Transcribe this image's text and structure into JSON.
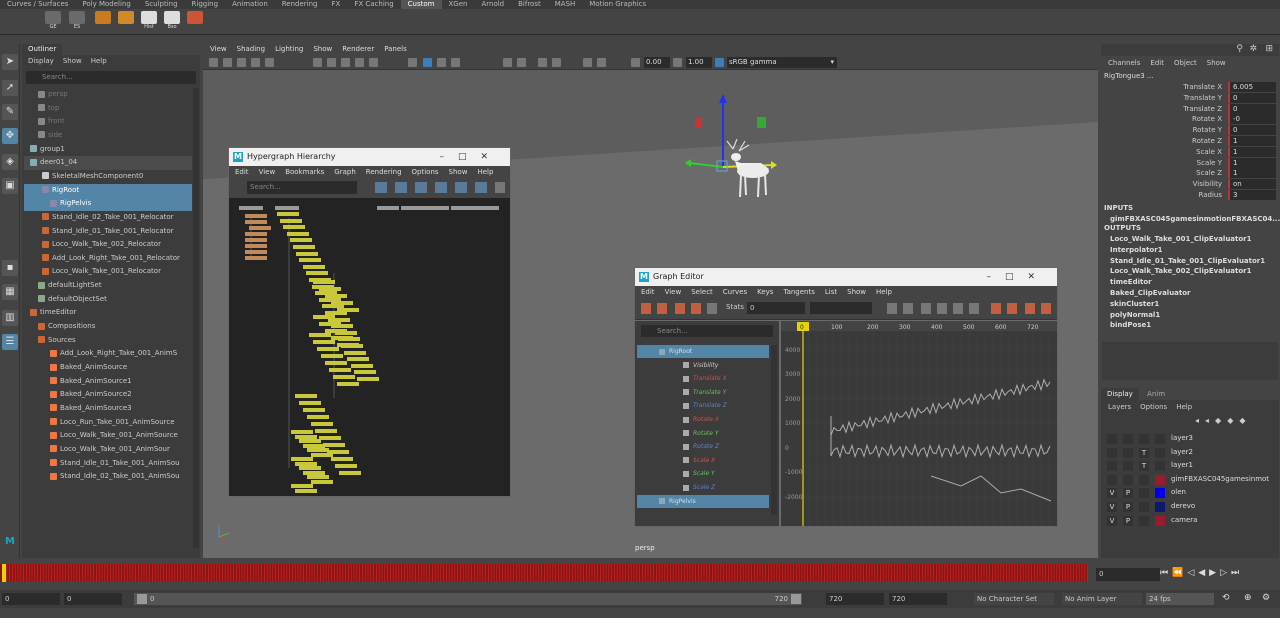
{
  "shelf": {
    "tabs": [
      "Curves / Surfaces",
      "Poly Modeling",
      "Sculpting",
      "Rigging",
      "Animation",
      "Rendering",
      "FX",
      "FX Caching",
      "Custom",
      "XGen",
      "Arnold",
      "Bifrost",
      "MASH",
      "Motion Graphics"
    ],
    "active_tab": "Custom",
    "buttons": [
      "GE",
      "ES",
      "",
      "",
      "Hist",
      "Bso",
      ""
    ]
  },
  "outliner": {
    "title": "Outliner",
    "menu": [
      "Display",
      "Show",
      "Help"
    ],
    "search_placeholder": "Search...",
    "items": [
      {
        "label": "persp",
        "state": "dim"
      },
      {
        "label": "top",
        "state": "dim"
      },
      {
        "label": "front",
        "state": "dim"
      },
      {
        "label": "side",
        "state": "dim"
      },
      {
        "label": "group1",
        "state": ""
      },
      {
        "label": "deer01_04",
        "state": "hl"
      },
      {
        "label": "SkeletalMeshComponent0",
        "state": ""
      },
      {
        "label": "RigRoot",
        "state": "sel"
      },
      {
        "label": "RigPelvis",
        "state": "sel"
      },
      {
        "label": "Stand_Idle_02_Take_001_Relocator",
        "state": ""
      },
      {
        "label": "Stand_Idle_01_Take_001_Relocator",
        "state": ""
      },
      {
        "label": "Loco_Walk_Take_002_Relocator",
        "state": ""
      },
      {
        "label": "Add_Look_Right_Take_001_Relocator",
        "state": ""
      },
      {
        "label": "Loco_Walk_Take_001_Relocator",
        "state": ""
      },
      {
        "label": "defaultLightSet",
        "state": ""
      },
      {
        "label": "defaultObjectSet",
        "state": ""
      },
      {
        "label": "timeEditor",
        "state": ""
      },
      {
        "label": "Compositions",
        "state": ""
      },
      {
        "label": "Sources",
        "state": ""
      },
      {
        "label": "Add_Look_Right_Take_001_AnimS",
        "state": ""
      },
      {
        "label": "Baked_AnimSource",
        "state": ""
      },
      {
        "label": "Baked_AnimSource1",
        "state": ""
      },
      {
        "label": "Baked_AnimSource2",
        "state": ""
      },
      {
        "label": "Baked_AnimSource3",
        "state": ""
      },
      {
        "label": "Loco_Run_Take_001_AnimSource",
        "state": ""
      },
      {
        "label": "Loco_Walk_Take_001_AnimSource",
        "state": ""
      },
      {
        "label": "Loco_Walk_Take_001_AnimSour",
        "state": ""
      },
      {
        "label": "Stand_Idle_01_Take_001_AnimSou",
        "state": ""
      },
      {
        "label": "Stand_Idle_02_Take_001_AnimSou",
        "state": ""
      }
    ]
  },
  "viewport": {
    "menu": [
      "View",
      "Shading",
      "Lighting",
      "Show",
      "Renderer",
      "Panels"
    ],
    "field_a": "0.00",
    "field_b": "1.00",
    "color_space": "sRGB gamma",
    "camera_label": "persp"
  },
  "hypergraph": {
    "title": "Hypergraph Hierarchy",
    "menu": [
      "Edit",
      "View",
      "Bookmarks",
      "Graph",
      "Rendering",
      "Options",
      "Show",
      "Help"
    ],
    "search_placeholder": "Search..."
  },
  "graph_editor": {
    "title": "Graph Editor",
    "menu": [
      "Edit",
      "View",
      "Select",
      "Curves",
      "Keys",
      "Tangents",
      "List",
      "Show",
      "Help"
    ],
    "stats_label": "Stats",
    "stats_value": "0",
    "search_placeholder": "Search...",
    "channels": [
      {
        "label": "RigRoot",
        "color": "#cfe4f0",
        "sel": true
      },
      {
        "label": "Visibility",
        "color": "#cccccc",
        "sel": false
      },
      {
        "label": "Translate X",
        "color": "#d05050",
        "sel": false
      },
      {
        "label": "Translate Y",
        "color": "#60c060",
        "sel": false
      },
      {
        "label": "Translate Z",
        "color": "#6080d0",
        "sel": false
      },
      {
        "label": "Rotate X",
        "color": "#d05050",
        "sel": false
      },
      {
        "label": "Rotate Y",
        "color": "#60c060",
        "sel": false
      },
      {
        "label": "Rotate Z",
        "color": "#6080d0",
        "sel": false
      },
      {
        "label": "Scale X",
        "color": "#d05050",
        "sel": false
      },
      {
        "label": "Scale Y",
        "color": "#60c060",
        "sel": false
      },
      {
        "label": "Scale Z",
        "color": "#6080d0",
        "sel": false
      },
      {
        "label": "RigPelvis",
        "color": "#cfe4f0",
        "sel": true
      }
    ],
    "frame_ruler": [
      "0",
      "100",
      "200",
      "300",
      "400",
      "500",
      "600",
      "720"
    ],
    "current_frame": "0",
    "value_ticks": [
      "4000",
      "3000",
      "2000",
      "1000",
      "0",
      "-1000",
      "-2000"
    ]
  },
  "channel_box": {
    "menu": [
      "Channels",
      "Edit",
      "Object",
      "Show"
    ],
    "object_name": "RigTongue3 ...",
    "attributes": [
      {
        "label": "Translate X",
        "value": "6.005"
      },
      {
        "label": "Translate Y",
        "value": "0"
      },
      {
        "label": "Translate Z",
        "value": "0"
      },
      {
        "label": "Rotate X",
        "value": "-0"
      },
      {
        "label": "Rotate Y",
        "value": "0"
      },
      {
        "label": "Rotate Z",
        "value": "1"
      },
      {
        "label": "Scale X",
        "value": "1"
      },
      {
        "label": "Scale Y",
        "value": "1"
      },
      {
        "label": "Scale Z",
        "value": "1"
      },
      {
        "label": "Visibility",
        "value": "on"
      },
      {
        "label": "Radius",
        "value": "3"
      }
    ],
    "inputs_header": "INPUTS",
    "inputs": [
      "gimFBXASC045gamesinmotionFBXASC04..."
    ],
    "outputs_header": "OUTPUTS",
    "outputs": [
      "Loco_Walk_Take_001_ClipEvaluator1",
      "Interpolator1",
      "Stand_Idle_01_Take_001_ClipEvaluator1",
      "Loco_Walk_Take_002_ClipEvaluator1",
      "timeEditor",
      "Baked_ClipEvaluator",
      "skinCluster1",
      "polyNormal1",
      "bindPose1"
    ]
  },
  "layers": {
    "tabs": [
      "Display",
      "Anim"
    ],
    "menu": [
      "Layers",
      "Options",
      "Help"
    ],
    "rows": [
      {
        "v": "",
        "p": "",
        "t": "",
        "name": "layer3",
        "color": "#333333"
      },
      {
        "v": "",
        "p": "",
        "t": "T",
        "name": "layer2",
        "color": "#333333"
      },
      {
        "v": "",
        "p": "",
        "t": "T",
        "name": "layer1",
        "color": "#333333"
      },
      {
        "v": "",
        "p": "",
        "t": "",
        "name": "gimFBXASC045gamesinmot",
        "color": "#9b1b2e"
      },
      {
        "v": "V",
        "p": "P",
        "t": "",
        "name": "olen",
        "color": "#0000ee"
      },
      {
        "v": "V",
        "p": "P",
        "t": "",
        "name": "derevo",
        "color": "#0a1a6a"
      },
      {
        "v": "V",
        "p": "P",
        "t": "",
        "name": "camera",
        "color": "#9b1b2e"
      }
    ]
  },
  "timeline": {
    "current_frame": "0"
  },
  "range": {
    "start": "0",
    "anim_start": "0",
    "slider_start": "0",
    "slider_end": "720",
    "anim_end": "720",
    "end": "720",
    "character_set": "No Character Set",
    "anim_layer": "No Anim Layer",
    "fps": "24 fps"
  }
}
